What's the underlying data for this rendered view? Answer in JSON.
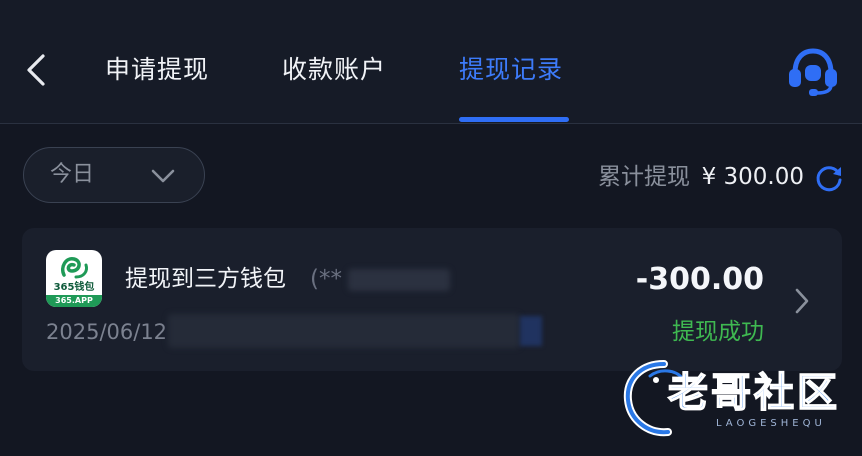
{
  "header": {
    "tabs": [
      {
        "label": "申请提现",
        "active": false
      },
      {
        "label": "收款账户",
        "active": false
      },
      {
        "label": "提现记录",
        "active": true
      }
    ],
    "back_icon": "chevron-left-icon",
    "support_icon": "headset-icon"
  },
  "filter": {
    "date_range": "今日",
    "total_label": "累计提现",
    "total_value": "¥ 300.00"
  },
  "records": [
    {
      "title": "提现到三方钱包",
      "title_suffix": "(**",
      "date": "2025/06/12",
      "amount": "-300.00",
      "status": "提现成功",
      "app_logo": {
        "top_text": "365钱包",
        "band_text": "365.APP"
      }
    }
  ],
  "watermark": {
    "text": "老哥社区",
    "sub": "LAOGESHEQU"
  },
  "colors": {
    "accent": "#3d7bfa",
    "success": "#3fb951",
    "background": "#131722",
    "card": "#1a1f2c"
  }
}
